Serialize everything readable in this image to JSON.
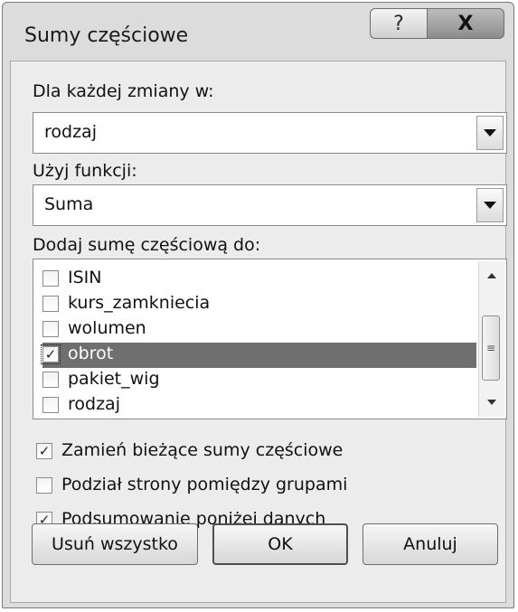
{
  "dialog": {
    "title": "Sumy częściowe",
    "help_glyph": "?",
    "close_glyph": "X"
  },
  "group_by": {
    "label": "Dla każdej zmiany w:",
    "value": "rodzaj"
  },
  "function": {
    "label": "Użyj funkcji:",
    "value": "Suma"
  },
  "add_subtotal": {
    "label": "Dodaj sumę częściową do:",
    "items": [
      {
        "label": "ISIN",
        "checked": false,
        "selected": false
      },
      {
        "label": "kurs_zamkniecia",
        "checked": false,
        "selected": false
      },
      {
        "label": "wolumen",
        "checked": false,
        "selected": false
      },
      {
        "label": "obrot",
        "checked": true,
        "selected": true
      },
      {
        "label": "pakiet_wig",
        "checked": false,
        "selected": false
      },
      {
        "label": "rodzaj",
        "checked": false,
        "selected": false
      }
    ]
  },
  "options": {
    "replace_current": {
      "label": "Zamień bieżące sumy częściowe",
      "checked": true
    },
    "page_break": {
      "label": "Podział strony pomiędzy grupami",
      "checked": false
    },
    "summary_below": {
      "label": "Podsumowanie poniżej danych",
      "checked": true
    }
  },
  "buttons": {
    "remove_all": "Usuń wszystko",
    "ok": "OK",
    "cancel": "Anuluj"
  },
  "icons": {
    "check": "✓",
    "dropdown": "chevron-down-icon"
  }
}
